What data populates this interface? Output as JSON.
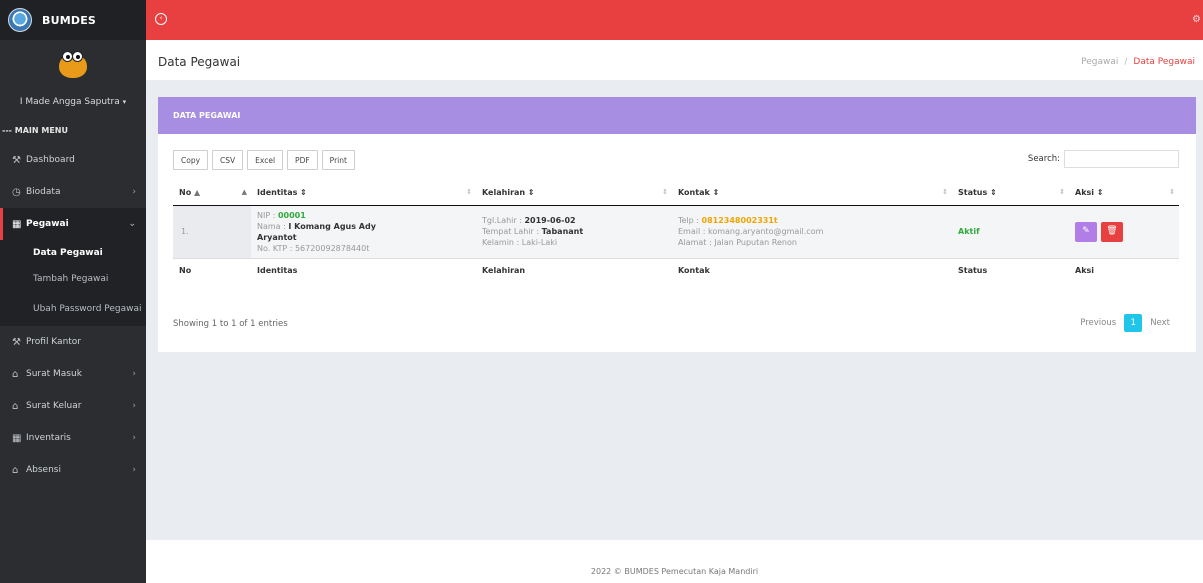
{
  "brand": {
    "title": "BUMDES"
  },
  "sidebar": {
    "user_name": "I Made Angga Saputra",
    "user_caret": "▾",
    "menu_label": "--- MAIN MENU",
    "items": {
      "dashboard": "Dashboard",
      "biodata": "Biodata",
      "pegawai": "Pegawai",
      "profil_kantor": "Profil Kantor",
      "surat_masuk": "Surat Masuk",
      "surat_keluar": "Surat Keluar",
      "inventaris": "Inventaris",
      "absensi": "Absensi"
    },
    "pegawai_sub": {
      "data": "Data Pegawai",
      "tambah": "Tambah Pegawai",
      "ubah_password": "Ubah Password Pegawai"
    }
  },
  "header": {
    "title": "Data Pegawai",
    "breadcrumb": [
      "Pegawai",
      "/",
      "Data Pegawai"
    ]
  },
  "card": {
    "title": "DATA PEGAWAI",
    "export_buttons": [
      "Copy",
      "CSV",
      "Excel",
      "PDF",
      "Print"
    ],
    "search_label": "Search:",
    "search_value": "",
    "columns": [
      "No",
      "Identitas",
      "Kelahiran",
      "Kontak",
      "Status",
      "Aksi"
    ],
    "row": {
      "no": "1.",
      "nip_label": "NIP : ",
      "nip": "00001",
      "nama_label": "Nama : ",
      "nama": "I Komang Agus Ady Aryantot",
      "ktp": "No. KTP : 56720092878440t",
      "tgl_label": "Tgl.Lahir : ",
      "tgl": "2019-06-02",
      "tempat_label": "Tempat Lahir : ",
      "tempat": "Tabanant",
      "kelamin": "Kelamin : Laki-Laki",
      "telp_label": "Telp : ",
      "telp": "0812348002331t",
      "email": "Email : komang.aryanto@gmail.com",
      "alamat": "Alamat : Jalan Puputan Renon",
      "status": "Aktif"
    },
    "info": "Showing 1 to 1 of 1 entries",
    "pager": {
      "prev": "Previous",
      "current": "1",
      "next": "Next"
    }
  },
  "footer": {
    "text": "2022 © BUMDES Pemecutan Kaja Mandiri"
  },
  "colors": {
    "topbar": "#e84041",
    "card_header": "#a78ee3",
    "sidebar": "#2b2d30",
    "active_page": "#20c6ea"
  }
}
